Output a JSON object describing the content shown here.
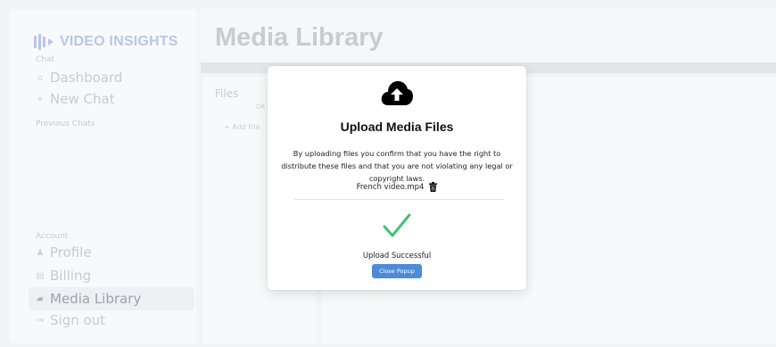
{
  "app": {
    "logo_text": "VIDEO INSIGHTS",
    "page_title": "Media Library"
  },
  "sidebar": {
    "section_chat": "Chat",
    "dashboard": {
      "label": "Dashboard",
      "icon": "home-icon"
    },
    "new_chat": {
      "label": "New Chat",
      "icon": "plus-icon"
    },
    "previous_chats": "Previous Chats",
    "section_account": "Account",
    "profile": {
      "label": "Profile",
      "icon": "user-icon"
    },
    "billing": {
      "label": "Billing",
      "icon": "card-icon"
    },
    "media_library": {
      "label": "Media Library",
      "icon": "folder-icon"
    },
    "sign_out": {
      "label": "Sign out",
      "icon": "sign-out-icon"
    }
  },
  "files_panel": {
    "title": "Files",
    "or_text": "OR",
    "add_file": "+ Add File"
  },
  "modal": {
    "icon": "cloud-upload-icon",
    "title": "Upload Media Files",
    "description": "By uploading files you confirm that you have the right to distribute these files and that you are not violating any legal or copyright laws.",
    "file_name": "French video.mp4",
    "status_icon": "checkmark-icon",
    "status_text": "Upload Successful",
    "close_button": "Close Popup"
  },
  "colors": {
    "accent": "#4e8bd6",
    "success": "#3ec46d"
  }
}
